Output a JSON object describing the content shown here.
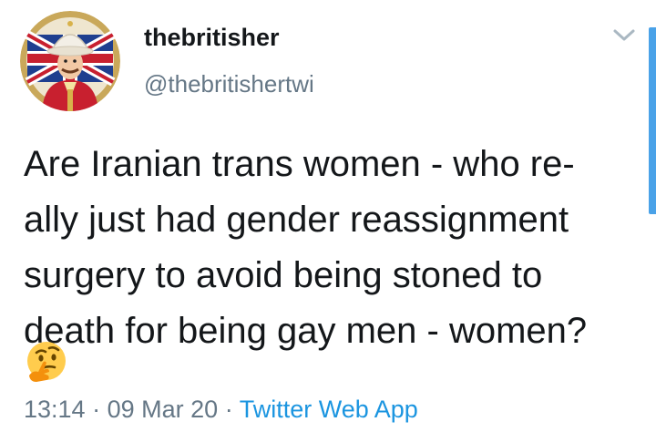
{
  "author": {
    "display_name": "thebritisher",
    "handle": "@thebritishertwi",
    "avatar_icon": "british-soldier-avatar-icon"
  },
  "tweet": {
    "lines": [
      "Are Iranian trans women - who re-",
      "ally just had gender reassignment",
      "surgery to avoid being stoned to",
      "death for being gay men - women?"
    ],
    "emoji": "thinking-face-icon"
  },
  "meta": {
    "time": "13:14",
    "separator": "·",
    "date": "09 Mar 20",
    "source": "Twitter Web App"
  },
  "colors": {
    "text": "#14171a",
    "secondary": "#657786",
    "link": "#1b95e0",
    "scroll_indicator": "#4aa2e8"
  }
}
